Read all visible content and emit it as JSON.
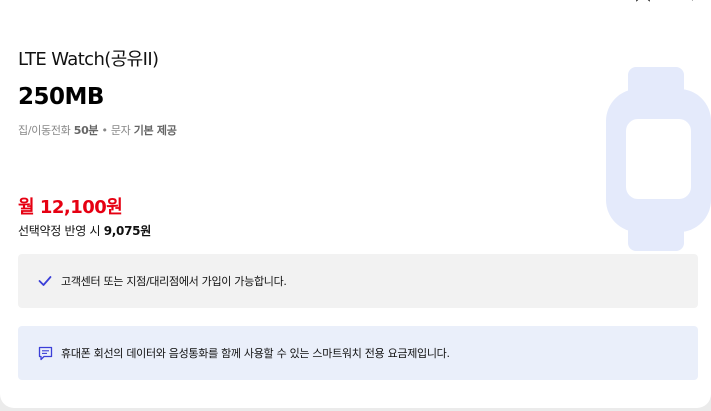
{
  "plan": {
    "name": "LTE Watch(공유II)",
    "data": "250MB",
    "benefits": {
      "prefix": "집/이동전화",
      "voice": "50분",
      "separator": "•",
      "sms_prefix": "문자",
      "sms": "기본 제공"
    },
    "price": "월 12,100원",
    "discount": {
      "label": "선택약정 반영 시",
      "amount": "9,075원"
    }
  },
  "notices": {
    "signup": "고객센터 또는 지점/대리점에서 가입이 가능합니다.",
    "description": "휴대폰 회선의 데이터와 음성통화를 함께 사용할 수 있는 스마트워치 전용 요금제입니다."
  },
  "colors": {
    "price": "#e60012",
    "accent": "#3b3fd8",
    "watch_illustration": "#e4eafb"
  },
  "icons": [
    "bookmark-icon",
    "search-icon",
    "check-icon",
    "chat-message-icon",
    "smartwatch-icon"
  ]
}
